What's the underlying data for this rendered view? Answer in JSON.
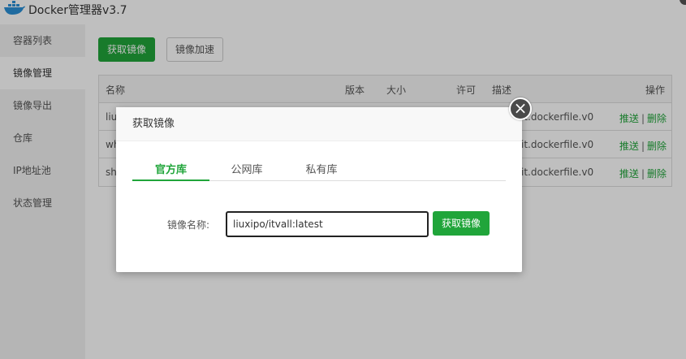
{
  "app": {
    "title": "Docker管理器v3.7",
    "logo_icon": "docker-whale-icon"
  },
  "sidebar": {
    "items": [
      {
        "label": "容器列表"
      },
      {
        "label": "镜像管理",
        "active": true
      },
      {
        "label": "镜像导出"
      },
      {
        "label": "仓库"
      },
      {
        "label": "IP地址池"
      },
      {
        "label": "状态管理"
      }
    ]
  },
  "toolbar": {
    "pull_label": "获取镜像",
    "accelerate_label": "镜像加速"
  },
  "table": {
    "headers": {
      "name": "名称",
      "version": "版本",
      "size": "大小",
      "license": "许可",
      "description": "描述",
      "actions": "操作"
    },
    "rows": [
      {
        "name": "liu",
        "description": "it.dockerfile.v0",
        "push": "推送",
        "delete": "删除"
      },
      {
        "name": "wh",
        "description": "it.dockerfile.v0",
        "push": "推送",
        "delete": "删除"
      },
      {
        "name": "sh",
        "description": "it.dockerfile.v0",
        "push": "推送",
        "delete": "删除"
      }
    ],
    "separator": "|"
  },
  "modal": {
    "title": "获取镜像",
    "close_icon": "×",
    "tabs": [
      {
        "label": "官方库",
        "active": true
      },
      {
        "label": "公网库"
      },
      {
        "label": "私有库"
      }
    ],
    "image_name_label": "镜像名称:",
    "image_name_value": "liuxipo/itvall:latest",
    "submit_label": "获取镜像"
  },
  "colors": {
    "accent": "#20a53a",
    "sidebar_bg": "#f2f2f2"
  }
}
